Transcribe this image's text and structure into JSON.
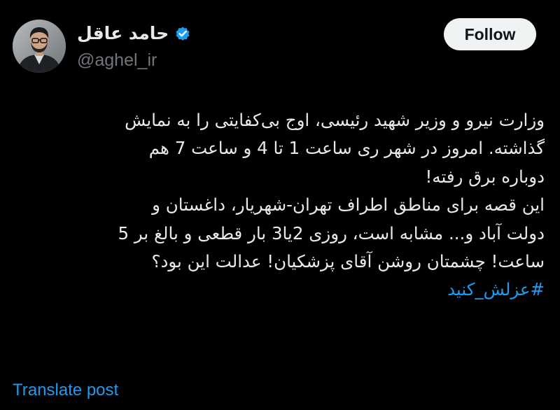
{
  "author": {
    "display_name": "حامد عاقل",
    "handle": "@aghel_ir",
    "verified": true,
    "avatar_icon": "avatar-photo"
  },
  "follow_button": {
    "label": "Follow"
  },
  "post": {
    "lines": [
      "وزارت نیرو و وزیر شهید رئیسی، اوج بی‌کفایتی را به نمایش",
      "گذاشته. امروز در شهر ری ساعت 1 تا 4 و ساعت 7 هم",
      "دوباره برق رفته!",
      "این قصه برای مناطق اطراف تهران-شهریار، داغستان و",
      "دولت آباد و... مشابه است، روزی 2یا3 بار قطعی و بالغ بر 5",
      "ساعت! چشمتان روشن آقای پزشکیان! عدالت این بود؟"
    ],
    "hashtag": "#عزلش_کنید"
  },
  "translate_link": {
    "label": "Translate post"
  },
  "colors": {
    "background": "#000000",
    "text": "#e7e9ea",
    "secondary_text": "#71767b",
    "link": "#1d9bf0",
    "verified_badge": "#1d9bf0",
    "follow_bg": "#eff3f4",
    "follow_text": "#0f1419"
  }
}
